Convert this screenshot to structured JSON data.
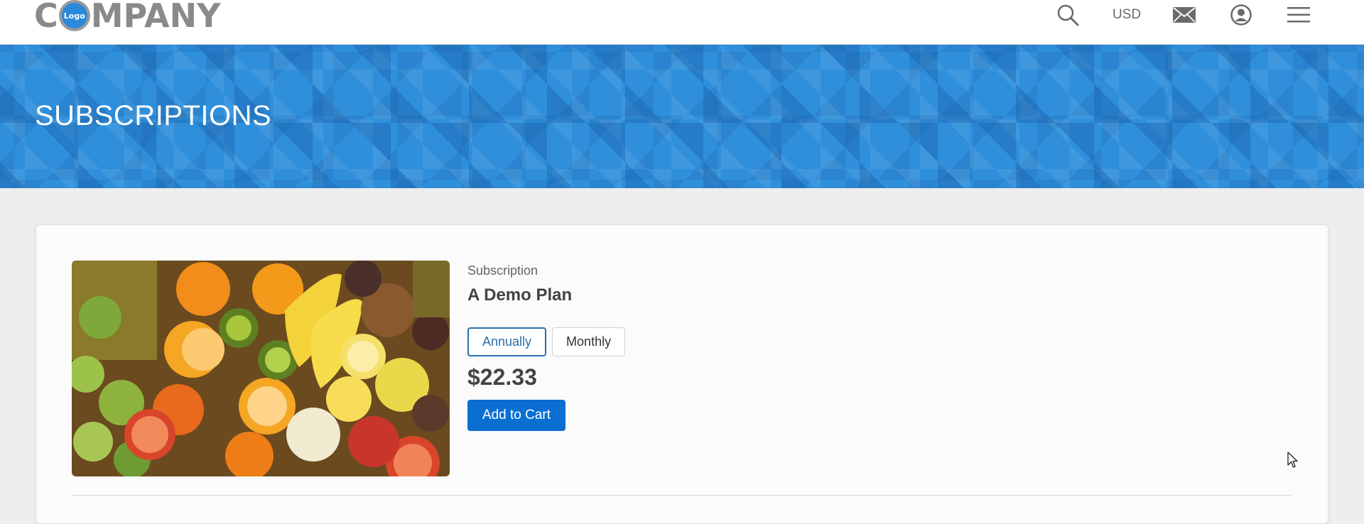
{
  "header": {
    "logo": {
      "prefix": "C",
      "badge": "Logo",
      "suffix": "MPANY"
    },
    "currency": "USD",
    "icons": [
      "search-icon",
      "mail-icon",
      "account-icon",
      "menu-icon"
    ]
  },
  "hero": {
    "title": "SUBSCRIPTIONS"
  },
  "product": {
    "category": "Subscription",
    "name": "A Demo Plan",
    "billing_options": [
      "Annually",
      "Monthly"
    ],
    "selected_billing": "Annually",
    "price": "$22.33",
    "add_to_cart_label": "Add to Cart",
    "image": "fruit-assortment-image"
  },
  "colors": {
    "brand_blue": "#2f8fdb",
    "button_blue": "#0a6fd1",
    "active_outline": "#2a6fa8",
    "logo_gray": "#8a8a8a"
  }
}
